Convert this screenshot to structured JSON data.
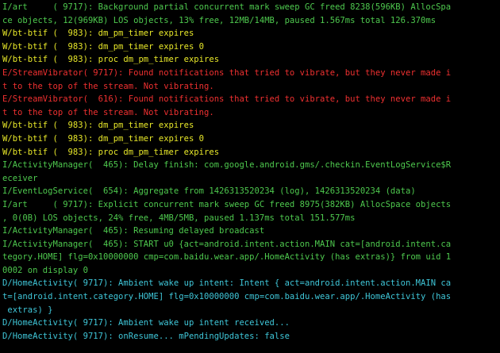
{
  "colors": {
    "I": "#4ec94e",
    "W": "#e6e629",
    "E": "#ee3030",
    "D": "#3fc6d8",
    "background": "#000000"
  },
  "log_lines": [
    {
      "level": "I",
      "text": "I/art     ( 9717): Background partial concurrent mark sweep GC freed 8238(596KB) AllocSpa"
    },
    {
      "level": "I",
      "text": "ce objects, 12(969KB) LOS objects, 13% free, 12MB/14MB, paused 1.567ms total 126.370ms"
    },
    {
      "level": "W",
      "text": "W/bt-btif (  983): dm_pm_timer expires"
    },
    {
      "level": "W",
      "text": "W/bt-btif (  983): dm_pm_timer expires 0"
    },
    {
      "level": "W",
      "text": "W/bt-btif (  983): proc dm_pm_timer expires"
    },
    {
      "level": "E",
      "text": "E/StreamVibrator( 9717): Found notifications that tried to vibrate, but they never made i"
    },
    {
      "level": "E",
      "text": "t to the top of the stream. Not vibrating."
    },
    {
      "level": "E",
      "text": "E/StreamVibrator(  616): Found notifications that tried to vibrate, but they never made i"
    },
    {
      "level": "E",
      "text": "t to the top of the stream. Not vibrating."
    },
    {
      "level": "W",
      "text": "W/bt-btif (  983): dm_pm_timer expires"
    },
    {
      "level": "W",
      "text": "W/bt-btif (  983): dm_pm_timer expires 0"
    },
    {
      "level": "W",
      "text": "W/bt-btif (  983): proc dm_pm_timer expires"
    },
    {
      "level": "I",
      "text": "I/ActivityManager(  465): Delay finish: com.google.android.gms/.checkin.EventLogService$R"
    },
    {
      "level": "I",
      "text": "eceiver"
    },
    {
      "level": "I",
      "text": "I/EventLogService(  654): Aggregate from 1426313520234 (log), 1426313520234 (data)"
    },
    {
      "level": "I",
      "text": "I/art     ( 9717): Explicit concurrent mark sweep GC freed 8975(382KB) AllocSpace objects"
    },
    {
      "level": "I",
      "text": ", 0(0B) LOS objects, 24% free, 4MB/5MB, paused 1.137ms total 151.577ms"
    },
    {
      "level": "I",
      "text": "I/ActivityManager(  465): Resuming delayed broadcast"
    },
    {
      "level": "I",
      "text": "I/ActivityManager(  465): START u0 {act=android.intent.action.MAIN cat=[android.intent.ca"
    },
    {
      "level": "I",
      "text": "tegory.HOME] flg=0x10000000 cmp=com.baidu.wear.app/.HomeActivity (has extras)} from uid 1"
    },
    {
      "level": "I",
      "text": "0002 on display 0"
    },
    {
      "level": "D",
      "text": "D/HomeActivity( 9717): Ambient wake up intent: Intent { act=android.intent.action.MAIN ca"
    },
    {
      "level": "D",
      "text": "t=[android.intent.category.HOME] flg=0x10000000 cmp=com.baidu.wear.app/.HomeActivity (has"
    },
    {
      "level": "D",
      "text": " extras) }"
    },
    {
      "level": "D",
      "text": "D/HomeActivity( 9717): Ambient wake up intent received..."
    },
    {
      "level": "D",
      "text": "D/HomeActivity( 9717): onResume... mPendingUpdates: false"
    }
  ]
}
